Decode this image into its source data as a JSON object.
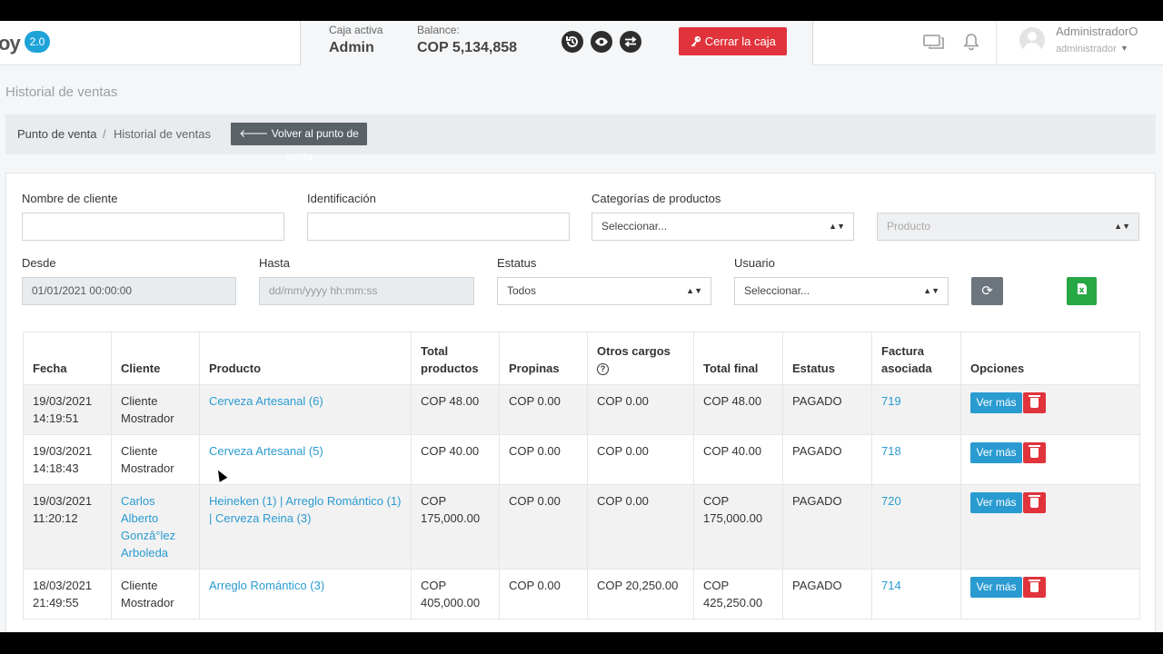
{
  "header": {
    "logo_fragment": "oy",
    "version": "2.0",
    "caja_label": "Caja activa",
    "caja_value": "Admin",
    "balance_label": "Balance:",
    "balance_value": "COP 5,134,858",
    "close_button": "Cerrar la caja",
    "user_name": "AdministradorO",
    "user_role": "administrador"
  },
  "page": {
    "title": "Historial de ventas",
    "breadcrumb": [
      "Punto de venta",
      "Historial de ventas"
    ],
    "back_button": "Volver al punto de venta"
  },
  "filters": {
    "client_name_label": "Nombre de cliente",
    "client_name_value": "",
    "identification_label": "Identificación",
    "identification_value": "",
    "categories_label": "Categorías de productos",
    "categories_value": "Seleccionar...",
    "product_value": "Producto",
    "from_label": "Desde",
    "from_value": "01/01/2021 00:00:00",
    "to_label": "Hasta",
    "to_placeholder": "dd/mm/yyyy hh:mm:ss",
    "status_label": "Estatus",
    "status_value": "Todos",
    "user_label": "Usuario",
    "user_value": "Seleccionar..."
  },
  "table": {
    "headers": {
      "fecha": "Fecha",
      "cliente": "Cliente",
      "producto": "Producto",
      "total_productos": "Total productos",
      "propinas": "Propinas",
      "otros_cargos": "Otros cargos",
      "total_final": "Total final",
      "estatus": "Estatus",
      "factura": "Factura asociada",
      "opciones": "Opciones"
    },
    "view_more_label": "Ver más",
    "rows": [
      {
        "fecha": "19/03/2021 14:19:51",
        "cliente": "Cliente Mostrador",
        "producto": "Cerveza Artesanal (6)",
        "total_productos": "COP 48.00",
        "propinas": "COP 0.00",
        "otros_cargos": "COP 0.00",
        "total_final": "COP 48.00",
        "estatus": "PAGADO",
        "factura": "719"
      },
      {
        "fecha": "19/03/2021 14:18:43",
        "cliente": "Cliente Mostrador",
        "producto": "Cerveza Artesanal (5)",
        "total_productos": "COP 40.00",
        "propinas": "COP 0.00",
        "otros_cargos": "COP 0.00",
        "total_final": "COP 40.00",
        "estatus": "PAGADO",
        "factura": "718"
      },
      {
        "fecha": "19/03/2021 11:20:12",
        "cliente": "Carlos Alberto Gonzâ°lez Arboleda",
        "producto": "Heineken (1) | Arreglo Romántico (1) | Cerveza Reina (3)",
        "total_productos": "COP 175,000.00",
        "propinas": "COP 0.00",
        "otros_cargos": "COP 0.00",
        "total_final": "COP 175,000.00",
        "estatus": "PAGADO",
        "factura": "720"
      },
      {
        "fecha": "18/03/2021 21:49:55",
        "cliente": "Cliente Mostrador",
        "producto": "Arreglo Romántico (3)",
        "total_productos": "COP 405,000.00",
        "propinas": "COP 0.00",
        "otros_cargos": "COP 20,250.00",
        "total_final": "COP 425,250.00",
        "estatus": "PAGADO",
        "factura": "714"
      }
    ]
  },
  "icons": {
    "history": "history-icon",
    "eye": "eye-icon",
    "swap": "swap-icon",
    "key": "key-icon",
    "chat": "chat-icon",
    "bell": "bell-icon",
    "refresh": "refresh-icon",
    "excel": "excel-icon",
    "trash": "trash-icon",
    "help": "help-icon"
  },
  "colors": {
    "primary": "#2a9bd1",
    "danger": "#e0333b",
    "success": "#28a745",
    "secondary": "#6c757d",
    "badge": "#1ea3d8"
  }
}
